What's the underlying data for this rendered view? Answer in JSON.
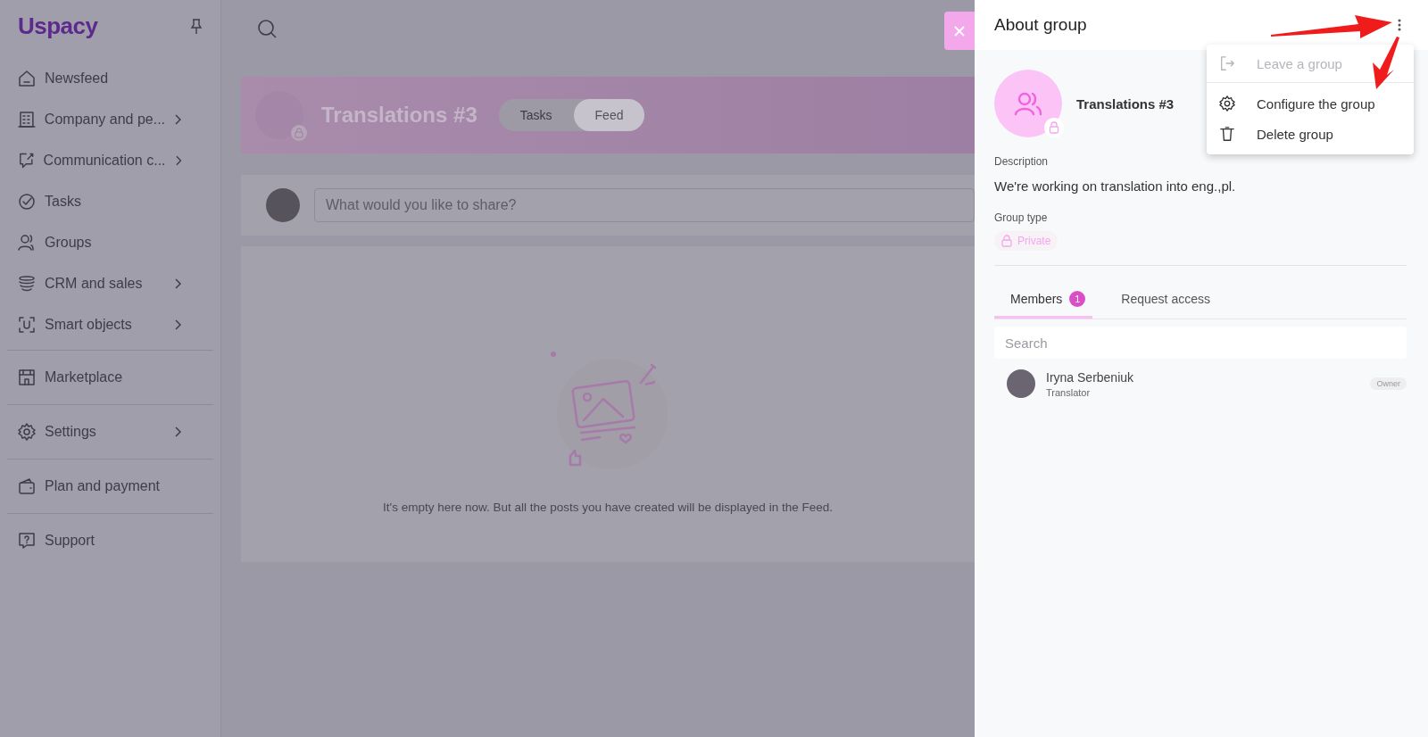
{
  "sidebar": {
    "logo": "Uspacy",
    "items": [
      {
        "kind": "home",
        "label": "Newsfeed",
        "submenu": false,
        "divider_before": false
      },
      {
        "kind": "building",
        "label": "Company and pe...",
        "submenu": true,
        "divider_before": false
      },
      {
        "kind": "chat",
        "label": "Communication c...",
        "submenu": true,
        "divider_before": false
      },
      {
        "kind": "check",
        "label": "Tasks",
        "submenu": false,
        "divider_before": false
      },
      {
        "kind": "people",
        "label": "Groups",
        "submenu": false,
        "divider_before": false
      },
      {
        "kind": "stack",
        "label": "CRM and sales",
        "submenu": true,
        "divider_before": false
      },
      {
        "kind": "scan",
        "label": "Smart objects",
        "submenu": true,
        "divider_before": false
      },
      {
        "kind": "store",
        "label": "Marketplace",
        "submenu": false,
        "divider_before": true
      },
      {
        "kind": "gear",
        "label": "Settings",
        "submenu": true,
        "divider_before": true
      },
      {
        "kind": "wallet",
        "label": "Plan and payment",
        "submenu": false,
        "divider_before": true
      },
      {
        "kind": "help",
        "label": "Support",
        "submenu": false,
        "divider_before": true
      }
    ]
  },
  "group_banner": {
    "title": "Translations #3",
    "tabs": [
      {
        "label": "Tasks",
        "selected": false
      },
      {
        "label": "Feed",
        "selected": true
      }
    ]
  },
  "composer": {
    "placeholder": "What would you like to share?"
  },
  "feed": {
    "empty_message": "It's empty here now. But all the posts you have created will be displayed in the Feed."
  },
  "panel": {
    "title": "About group",
    "menu": [
      {
        "kind": "exit",
        "label": "Leave a group",
        "disabled": true
      },
      {
        "kind": "gear",
        "label": "Configure the group",
        "disabled": false
      },
      {
        "kind": "trash",
        "label": "Delete group",
        "disabled": false
      }
    ],
    "group_name": "Translations #3",
    "description_label": "Description",
    "description": "We're working on translation into eng.,pl.",
    "type_label": "Group type",
    "type": "Private",
    "tabs": [
      {
        "label": "Members",
        "count": "1",
        "selected": true
      },
      {
        "label": "Request access",
        "selected": false
      }
    ],
    "search": {
      "placeholder": "Search"
    },
    "members": [
      {
        "name": "Iryna Serbeniuk",
        "role": "Translator",
        "badge": "Owner"
      }
    ]
  }
}
